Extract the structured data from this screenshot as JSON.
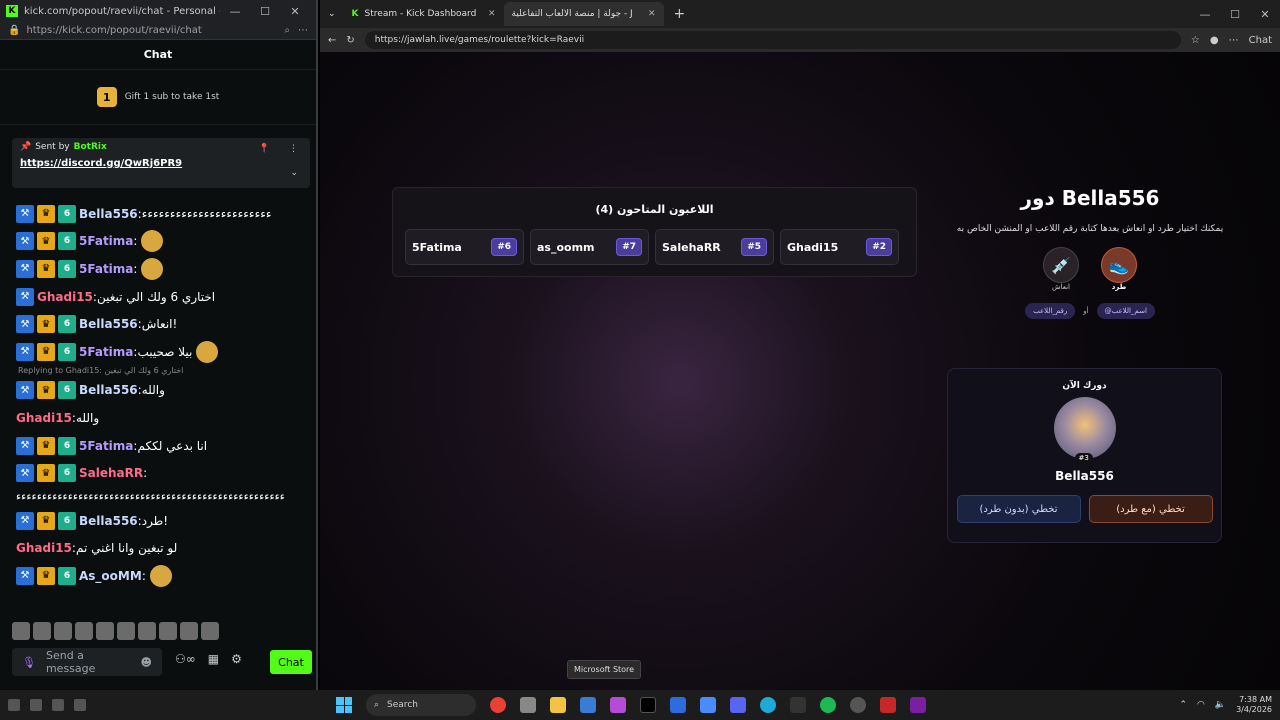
{
  "kick_window": {
    "title": "kick.com/popout/raevii/chat - Personal - Micros...",
    "url": "https://kick.com/popout/raevii/chat",
    "chat_header": "Chat",
    "gift": {
      "rank": "1",
      "text": "Gift 1 sub to take 1st"
    },
    "pinned": {
      "sent_by": "Sent by",
      "bot": "BotRix",
      "link": "https://discord.gg/QwRj6PR9"
    },
    "messages": [
      {
        "user": "Bella556",
        "text": "ﺀﺀﺀﺀﺀﺀﺀﺀﺀﺀﺀﺀﺀﺀﺀﺀﺀﺀﺀﺀﺀﺀﺀ",
        "color": "#c8d8ff",
        "badges": 3
      },
      {
        "user": "5Fatima",
        "text": "",
        "color": "#b69bff",
        "badges": 3,
        "emote": true
      },
      {
        "user": "5Fatima",
        "text": "",
        "color": "#b69bff",
        "badges": 3,
        "emote": true
      },
      {
        "user": "Ghadi15",
        "text": "اختاري 6 ولك الي تبغين",
        "color": "#ff6b8a",
        "badges": 1
      },
      {
        "user": "Bella556",
        "text": "انعاش!",
        "color": "#c8d8ff",
        "badges": 3
      },
      {
        "user": "5Fatima",
        "text": "بيلا صحيبب",
        "color": "#b69bff",
        "badges": 3,
        "emote": true
      },
      {
        "user": "Bella556",
        "text": "والله",
        "color": "#c8d8ff",
        "badges": 3,
        "reply": "Replying to Ghadi15: اختاري 6 ولك الي تبغين"
      },
      {
        "user": "Ghadi15",
        "text": "والله",
        "color": "#ff6b8a",
        "badges": 0
      },
      {
        "user": "5Fatima",
        "text": "انا بدعي لككم",
        "color": "#b69bff",
        "badges": 3
      },
      {
        "user": "SalehaRR",
        "text": "",
        "color": "#ff6b8a",
        "badges": 3,
        "long": "ﺀﺀﺀﺀﺀﺀﺀﺀﺀﺀﺀﺀﺀﺀﺀﺀﺀﺀﺀﺀﺀﺀﺀﺀﺀﺀﺀﺀﺀﺀﺀﺀﺀﺀﺀﺀﺀﺀﺀﺀﺀﺀﺀﺀﺀﺀﺀﺀﺀﺀﺀﺀ"
      },
      {
        "user": "Bella556",
        "text": "طرد!",
        "color": "#c8d8ff",
        "badges": 3
      },
      {
        "user": "Ghadi15",
        "text": "لو تبغين وانا اغني تم",
        "color": "#ff6b8a",
        "badges": 0
      },
      {
        "user": "As_ooMM",
        "text": "",
        "color": "#c8d8ff",
        "badges": 3,
        "emote": true
      }
    ],
    "input_placeholder": "Send a message",
    "chat_button": "Chat"
  },
  "edge_window": {
    "tab1": "Stream - Kick Dashboard",
    "tab2": "جولة | منصة الألعاب التفاعلية - Jawlah",
    "url": "https://jawlah.live/games/roulette?kick=Raevii",
    "sidebar_chat": "Chat",
    "players_title": "اللاعبون المتاحون (4)",
    "players": [
      {
        "name": "5Fatima",
        "num": "#6"
      },
      {
        "name": "as_oomm",
        "num": "#7"
      },
      {
        "name": "SalehaRR",
        "num": "#5"
      },
      {
        "name": "Ghadi15",
        "num": "#2"
      }
    ],
    "turn_title": "دور Bella556",
    "turn_desc": "يمكنك اختيار طرد او انعاش بعدها كتابة رقم اللاعب او المنشن الخاص به",
    "action_revive": "انعاش",
    "action_kick": "طرد",
    "tag_number": "رقم_اللاعب",
    "tag_or": "أو",
    "tag_name": "@اسم_اللاعب",
    "card_label": "دورك الآن",
    "card_num": "#3",
    "card_name": "Bella556",
    "btn_skip_no_kick": "تخطي (بدون طرد)",
    "btn_skip_kick": "تخطي (مع طرد)"
  },
  "taskbar": {
    "search": "Search",
    "tooltip": "Microsoft Store",
    "time": "7:38 AM",
    "date": "3/4/2026"
  }
}
